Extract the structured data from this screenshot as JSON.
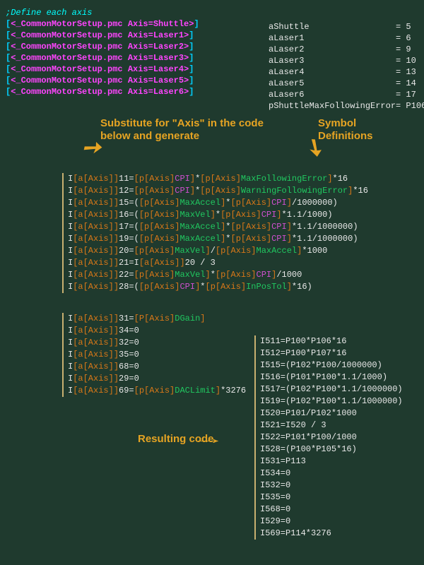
{
  "comment": ";Define each axis",
  "includes": [
    "[<_CommonMotorSetup.pmc Axis=Shuttle>]",
    "[<_CommonMotorSetup.pmc Axis=Laser1>]",
    "[<_CommonMotorSetup.pmc Axis=Laser2>]",
    "[<_CommonMotorSetup.pmc Axis=Laser3>]",
    "[<_CommonMotorSetup.pmc Axis=Laser4>]",
    "[<_CommonMotorSetup.pmc Axis=Laser5>]",
    "[<_CommonMotorSetup.pmc Axis=Laser6>]"
  ],
  "symbols": [
    {
      "name": "aShuttle",
      "val": "5"
    },
    {
      "name": "aLaser1",
      "val": "6"
    },
    {
      "name": "aLaser2",
      "val": "9"
    },
    {
      "name": "aLaser3",
      "val": "10"
    },
    {
      "name": "aLaser4",
      "val": "13"
    },
    {
      "name": "aLaser5",
      "val": "14"
    },
    {
      "name": "aLaser6",
      "val": "17"
    },
    {
      "name": "pShuttleMaxFollowingError",
      "val": "P106"
    }
  ],
  "labels": {
    "substitute": "Substitute for \"Axis\" in the code below and generate",
    "symdef": "Symbol Definitions",
    "resulting": "Resulting code"
  },
  "template_block1": [
    {
      "n": "11",
      "rhs": [
        {
          "t": "br",
          "v": "["
        },
        {
          "t": "p",
          "v": "p[Axis]"
        },
        {
          "t": "cpi",
          "v": "CPI"
        },
        {
          "t": "br",
          "v": "]"
        },
        {
          "t": "op",
          "v": "*"
        },
        {
          "t": "br",
          "v": "["
        },
        {
          "t": "p",
          "v": "p[Axis]"
        },
        {
          "t": "max",
          "v": "MaxFollowingError"
        },
        {
          "t": "br",
          "v": "]"
        },
        {
          "t": "op",
          "v": "*16"
        }
      ]
    },
    {
      "n": "12",
      "rhs": [
        {
          "t": "br",
          "v": "["
        },
        {
          "t": "p",
          "v": "p[Axis]"
        },
        {
          "t": "cpi",
          "v": "CPI"
        },
        {
          "t": "br",
          "v": "]"
        },
        {
          "t": "op",
          "v": "*"
        },
        {
          "t": "br",
          "v": "["
        },
        {
          "t": "p",
          "v": "p[Axis]"
        },
        {
          "t": "max",
          "v": "WarningFollowingError"
        },
        {
          "t": "br",
          "v": "]"
        },
        {
          "t": "op",
          "v": "*16"
        }
      ]
    },
    {
      "n": "15",
      "rhs": [
        {
          "t": "op",
          "v": "("
        },
        {
          "t": "br",
          "v": "["
        },
        {
          "t": "p",
          "v": "p[Axis]"
        },
        {
          "t": "max",
          "v": "MaxAccel"
        },
        {
          "t": "br",
          "v": "]"
        },
        {
          "t": "op",
          "v": "*"
        },
        {
          "t": "br",
          "v": "["
        },
        {
          "t": "p",
          "v": "p[Axis]"
        },
        {
          "t": "cpi",
          "v": "CPI"
        },
        {
          "t": "br",
          "v": "]"
        },
        {
          "t": "op",
          "v": "/1000000)"
        }
      ]
    },
    {
      "n": "16",
      "rhs": [
        {
          "t": "op",
          "v": "("
        },
        {
          "t": "br",
          "v": "["
        },
        {
          "t": "p",
          "v": "p[Axis]"
        },
        {
          "t": "max",
          "v": "MaxVel"
        },
        {
          "t": "br",
          "v": "]"
        },
        {
          "t": "op",
          "v": "*"
        },
        {
          "t": "br",
          "v": "["
        },
        {
          "t": "p",
          "v": "p[Axis]"
        },
        {
          "t": "cpi",
          "v": "CPI"
        },
        {
          "t": "br",
          "v": "]"
        },
        {
          "t": "op",
          "v": "*1.1/1000)"
        }
      ]
    },
    {
      "n": "17",
      "rhs": [
        {
          "t": "op",
          "v": "("
        },
        {
          "t": "br",
          "v": "["
        },
        {
          "t": "p",
          "v": "p[Axis]"
        },
        {
          "t": "max",
          "v": "MaxAccel"
        },
        {
          "t": "br",
          "v": "]"
        },
        {
          "t": "op",
          "v": "*"
        },
        {
          "t": "br",
          "v": "["
        },
        {
          "t": "p",
          "v": "p[Axis]"
        },
        {
          "t": "cpi",
          "v": "CPI"
        },
        {
          "t": "br",
          "v": "]"
        },
        {
          "t": "op",
          "v": "*1.1/1000000)"
        }
      ]
    },
    {
      "n": "19",
      "rhs": [
        {
          "t": "op",
          "v": "("
        },
        {
          "t": "br",
          "v": "["
        },
        {
          "t": "p",
          "v": "p[Axis]"
        },
        {
          "t": "max",
          "v": "MaxAccel"
        },
        {
          "t": "br",
          "v": "]"
        },
        {
          "t": "op",
          "v": "*"
        },
        {
          "t": "br",
          "v": "["
        },
        {
          "t": "p",
          "v": "p[Axis]"
        },
        {
          "t": "cpi",
          "v": "CPI"
        },
        {
          "t": "br",
          "v": "]"
        },
        {
          "t": "op",
          "v": "*1.1/1000000)"
        }
      ]
    },
    {
      "n": "20",
      "rhs": [
        {
          "t": "br",
          "v": "["
        },
        {
          "t": "p",
          "v": "p[Axis]"
        },
        {
          "t": "max",
          "v": "MaxVel"
        },
        {
          "t": "br",
          "v": "]"
        },
        {
          "t": "op",
          "v": "/"
        },
        {
          "t": "br",
          "v": "["
        },
        {
          "t": "p",
          "v": "p[Axis]"
        },
        {
          "t": "max",
          "v": "MaxAccel"
        },
        {
          "t": "br",
          "v": "]"
        },
        {
          "t": "op",
          "v": "*1000"
        }
      ]
    },
    {
      "n": "21",
      "rhs": [
        {
          "t": "op",
          "v": "I"
        },
        {
          "t": "br",
          "v": "["
        },
        {
          "t": "a",
          "v": "a[Axis]"
        },
        {
          "t": "br",
          "v": "]"
        },
        {
          "t": "op",
          "v": "20 / 3"
        }
      ]
    },
    {
      "n": "22",
      "rhs": [
        {
          "t": "br",
          "v": "["
        },
        {
          "t": "p",
          "v": "p[Axis]"
        },
        {
          "t": "max",
          "v": "MaxVel"
        },
        {
          "t": "br",
          "v": "]"
        },
        {
          "t": "op",
          "v": "*"
        },
        {
          "t": "br",
          "v": "["
        },
        {
          "t": "p",
          "v": "p[Axis]"
        },
        {
          "t": "cpi",
          "v": "CPI"
        },
        {
          "t": "br",
          "v": "]"
        },
        {
          "t": "op",
          "v": "/1000"
        }
      ]
    },
    {
      "n": "28",
      "rhs": [
        {
          "t": "op",
          "v": "("
        },
        {
          "t": "br",
          "v": "["
        },
        {
          "t": "p",
          "v": "p[Axis]"
        },
        {
          "t": "cpi",
          "v": "CPI"
        },
        {
          "t": "br",
          "v": "]"
        },
        {
          "t": "op",
          "v": "*"
        },
        {
          "t": "br",
          "v": "["
        },
        {
          "t": "p",
          "v": "p[Axis]"
        },
        {
          "t": "max",
          "v": "InPosTol"
        },
        {
          "t": "br",
          "v": "]"
        },
        {
          "t": "op",
          "v": "*16)"
        }
      ]
    }
  ],
  "template_block2": [
    {
      "n": "31",
      "rhs": [
        {
          "t": "br",
          "v": "["
        },
        {
          "t": "p",
          "v": "P[Axis]"
        },
        {
          "t": "max",
          "v": "DGain"
        },
        {
          "t": "br",
          "v": "]"
        }
      ]
    },
    {
      "n": "34",
      "rhs": [
        {
          "t": "op",
          "v": "0"
        }
      ]
    },
    {
      "n": "32",
      "rhs": [
        {
          "t": "op",
          "v": "0"
        }
      ]
    },
    {
      "n": "35",
      "rhs": [
        {
          "t": "op",
          "v": "0"
        }
      ]
    },
    {
      "n": "68",
      "rhs": [
        {
          "t": "op",
          "v": "0"
        }
      ]
    },
    {
      "n": "29",
      "rhs": [
        {
          "t": "op",
          "v": "0"
        }
      ]
    },
    {
      "n": "69",
      "rhs": [
        {
          "t": "br",
          "v": "["
        },
        {
          "t": "p",
          "v": "p[Axis]"
        },
        {
          "t": "max",
          "v": "DACLimit"
        },
        {
          "t": "br",
          "v": "]"
        },
        {
          "t": "op",
          "v": "*3276"
        }
      ]
    }
  ],
  "result_block": [
    "I511=P100*P106*16",
    "I512=P100*P107*16",
    "I515=(P102*P100/1000000)",
    "I516=(P101*P100*1.1/1000)",
    "I517=(P102*P100*1.1/1000000)",
    "I519=(P102*P100*1.1/1000000)",
    "I520=P101/P102*1000",
    "I521=I520 / 3",
    "I522=P101*P100/1000",
    "I528=(P100*P105*16)",
    "I531=P113",
    "I534=0",
    "I532=0",
    "I535=0",
    "I568=0",
    "I529=0",
    "I569=P114*3276"
  ]
}
